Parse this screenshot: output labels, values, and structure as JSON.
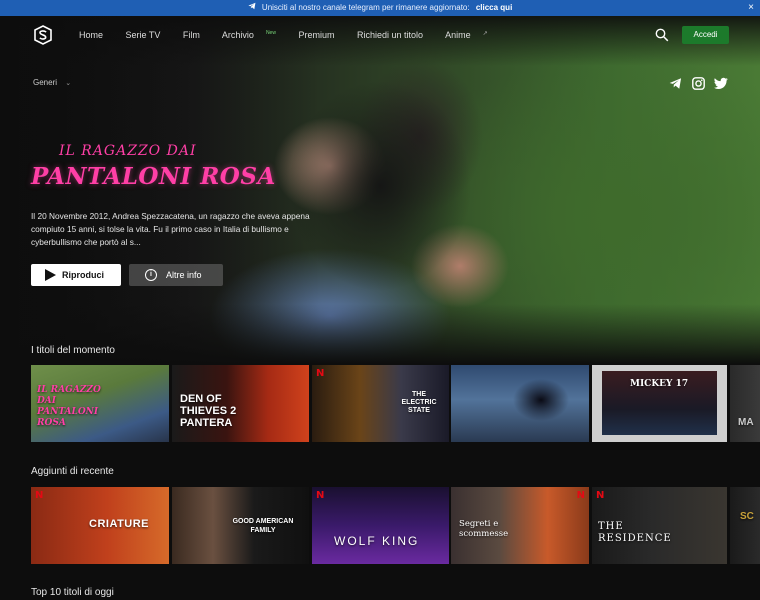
{
  "banner": {
    "text": "Unisciti al nostro canale telegram per rimanere aggiornato:",
    "link": "clicca qui",
    "close": "×"
  },
  "nav": {
    "items": [
      {
        "label": "Home"
      },
      {
        "label": "Serie TV"
      },
      {
        "label": "Film"
      },
      {
        "label": "Archivio",
        "badge": "New"
      },
      {
        "label": "Premium"
      },
      {
        "label": "Richiedi un titolo"
      },
      {
        "label": "Anime"
      }
    ],
    "login_label": "Accedi"
  },
  "genres_label": "Generi",
  "social_icons": [
    "telegram-icon",
    "instagram-icon",
    "twitter-icon"
  ],
  "hero": {
    "title_line1": "IL RAGAZZO DAI",
    "title_line2": "PANTALONI ROSA",
    "synopsis": "Il 20 Novembre 2012, Andrea Spezzacatena, un ragazzo che aveva appena compiuto 15 anni, si tolse la vita. Fu il primo caso in Italia di bullismo e cyberbullismo che portò al s...",
    "play_label": "Riproduci",
    "info_label": "Altre info"
  },
  "sections": {
    "trending": {
      "title": "I titoli del momento",
      "cards": [
        {
          "caption": "IL RAGAZZO DAI PANTALONI ROSA",
          "netflix": false
        },
        {
          "caption": "DEN OF THIEVES 2 PANTERA",
          "netflix": false
        },
        {
          "caption": "THE ELECTRIC STATE",
          "netflix": true
        },
        {
          "caption": "",
          "netflix": false
        },
        {
          "caption": "MICKEY 17",
          "netflix": false
        },
        {
          "caption": "MA",
          "netflix": false
        }
      ]
    },
    "recent": {
      "title": "Aggiunti di recente",
      "cards": [
        {
          "caption": "CRIATURE",
          "netflix": true
        },
        {
          "caption": "GOOD AMERICAN FAMILY",
          "netflix": false
        },
        {
          "caption": "WOLF KING",
          "netflix": true
        },
        {
          "caption": "Segreti e scommesse",
          "netflix": true
        },
        {
          "caption": "THE RESIDENCE",
          "netflix": true
        },
        {
          "caption": "SC",
          "netflix": false
        }
      ]
    },
    "top10": {
      "title": "Top 10 titoli di oggi"
    }
  },
  "colors": {
    "accent_green": "#1c7a2b",
    "banner_blue": "#1f5fb4",
    "title_pink": "#ff3fa6",
    "netflix_red": "#e50914"
  }
}
